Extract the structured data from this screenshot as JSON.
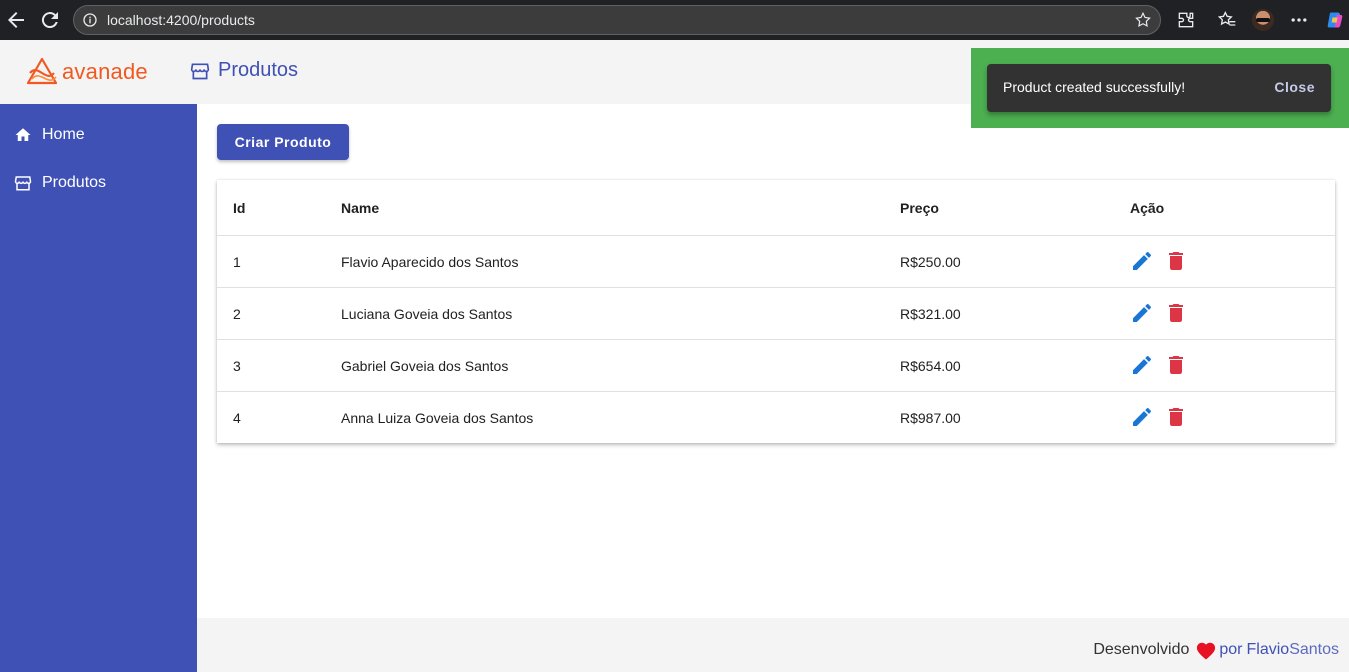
{
  "browser": {
    "url": "localhost:4200/products"
  },
  "header": {
    "brand": "avanade",
    "title": "Produtos"
  },
  "sidebar": {
    "items": [
      {
        "label": "Home",
        "icon": "home-icon"
      },
      {
        "label": "Produtos",
        "icon": "store-icon"
      }
    ]
  },
  "main": {
    "create_button": "Criar Produto",
    "table": {
      "columns": [
        "Id",
        "Name",
        "Preço",
        "Ação"
      ],
      "rows": [
        {
          "id": "1",
          "name": "Flavio Aparecido dos Santos",
          "price": "R$250.00"
        },
        {
          "id": "2",
          "name": "Luciana Goveia dos Santos",
          "price": "R$321.00"
        },
        {
          "id": "3",
          "name": "Gabriel Goveia dos Santos",
          "price": "R$654.00"
        },
        {
          "id": "4",
          "name": "Anna Luiza Goveia dos Santos",
          "price": "R$987.00"
        }
      ]
    }
  },
  "snackbar": {
    "message": "Product created successfully!",
    "action": "Close"
  },
  "footer": {
    "developed": "Desenvolvido",
    "by": "por",
    "author_first": "Flavio",
    "author_last": "Santos"
  },
  "colors": {
    "primary": "#3f51b5",
    "brand_orange": "#f05a22",
    "edit_blue": "#1976d2",
    "delete_red": "#dc3545",
    "snack_bg": "#4caf50"
  }
}
